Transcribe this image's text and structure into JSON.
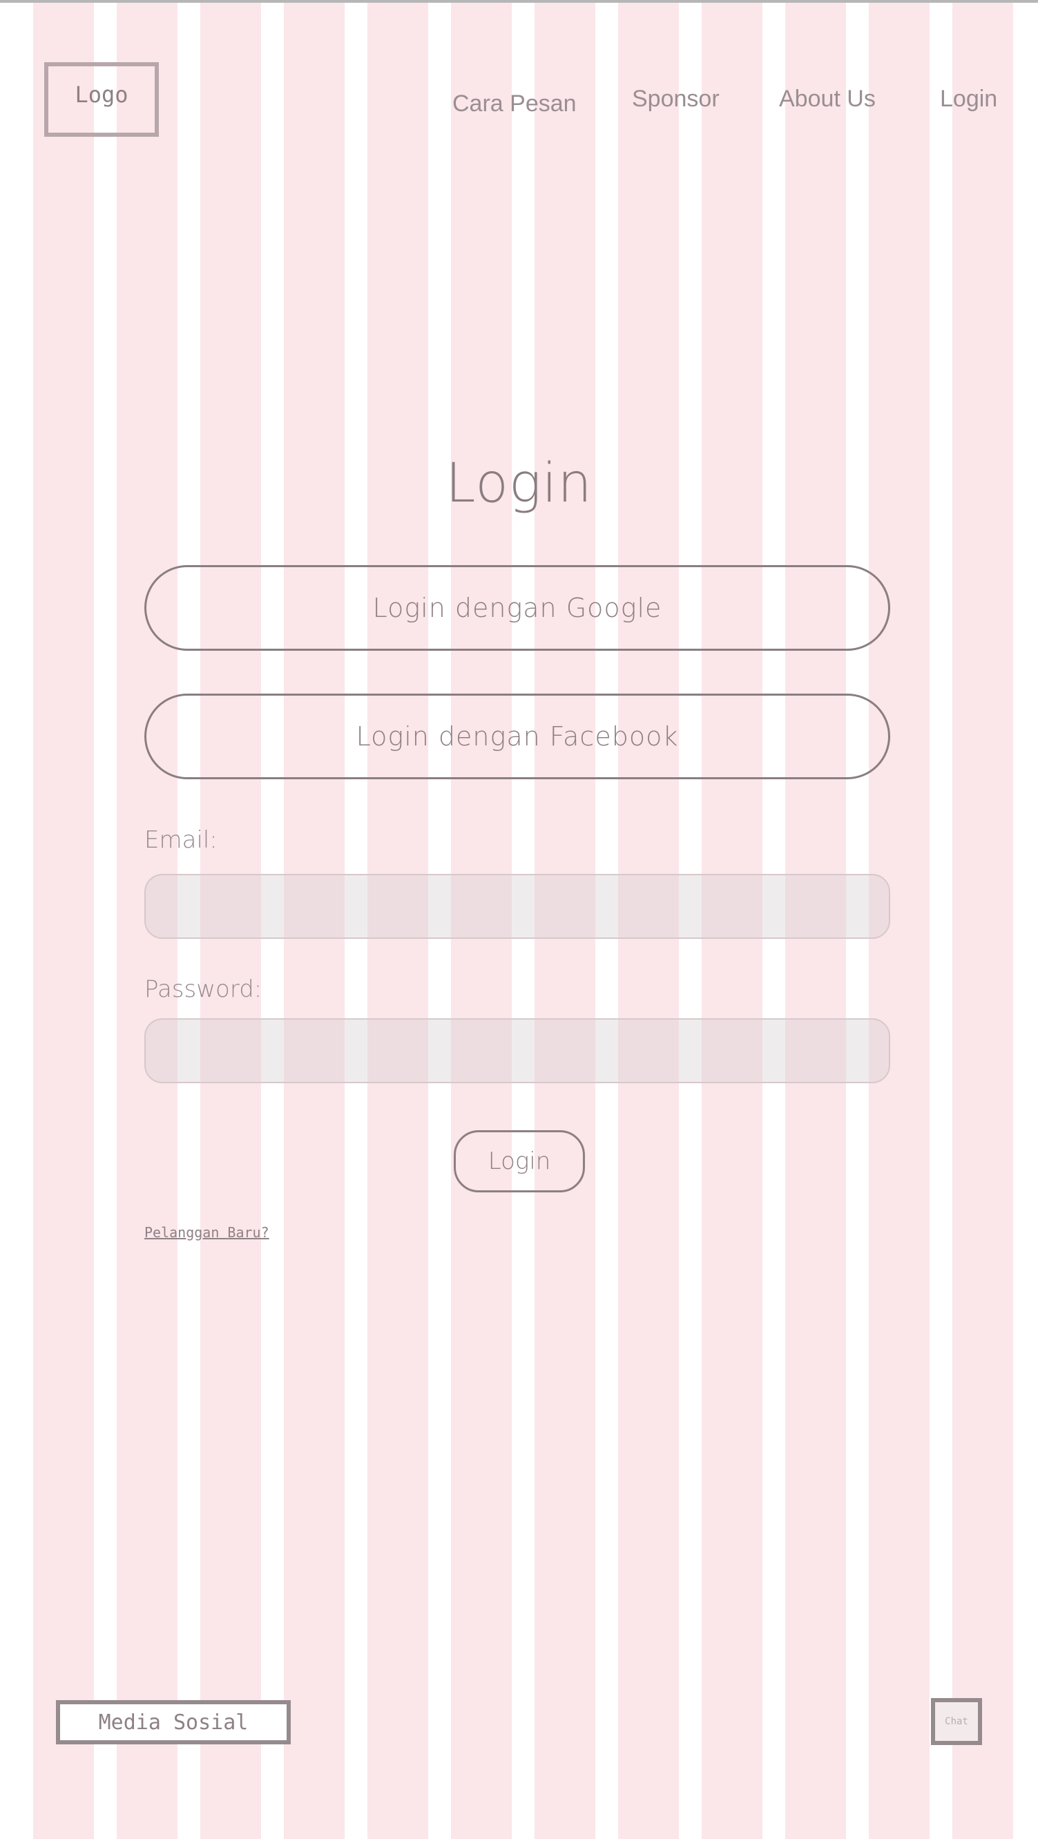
{
  "header": {
    "logo_text": "Logo",
    "nav": [
      "Cara Pesan",
      "Sponsor",
      "About Us",
      "Login"
    ]
  },
  "main": {
    "title": "Login",
    "google_button": "Login dengan Google",
    "facebook_button": "Login dengan Facebook",
    "email_label": "Email:",
    "email_value": "",
    "password_label": "Password:",
    "password_value": "",
    "submit_button": "Login",
    "register_link": "Pelanggan Baru?"
  },
  "footer": {
    "social_label": "Media Sosial",
    "chat_label": "Chat"
  },
  "colors": {
    "grid_column": "#f4bec4",
    "outline": "#8a7e82",
    "text": "#8a7c80"
  }
}
